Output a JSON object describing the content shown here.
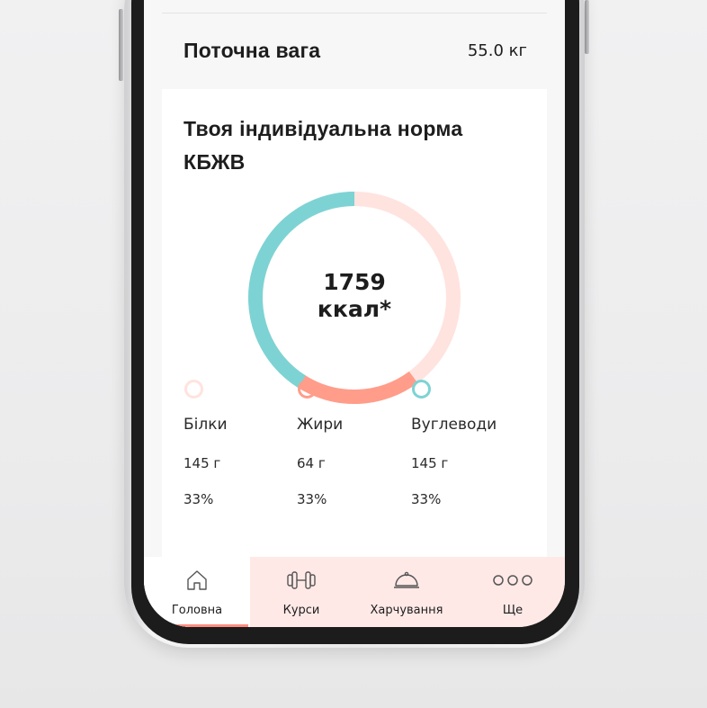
{
  "weight": {
    "label": "Поточна вага",
    "value": "55.0 кг"
  },
  "norm_card": {
    "title": "Твоя індивідуальна норма КБЖВ",
    "kcal_value": "1759",
    "kcal_unit": "ккал*"
  },
  "macros": [
    {
      "name": "Білки",
      "grams": "145 г",
      "percent": "33%",
      "color": "#ffe3df",
      "share": 0.33
    },
    {
      "name": "Жири",
      "grams": "64 г",
      "percent": "33%",
      "color": "#ff9d8a",
      "share": 0.33
    },
    {
      "name": "Вуглеводи",
      "grams": "145 г",
      "percent": "33%",
      "color": "#7dd3d4",
      "share": 0.33
    }
  ],
  "tabbar": {
    "tabs": [
      {
        "label": "Головна",
        "icon": "home-icon",
        "active": true
      },
      {
        "label": "Курси",
        "icon": "dumbbell-icon",
        "active": false
      },
      {
        "label": "Харчування",
        "icon": "cloche-icon",
        "active": false
      },
      {
        "label": "Ще",
        "icon": "more-icon",
        "active": false
      }
    ]
  },
  "colors": {
    "accent": "#ff8d7f",
    "tab_bg": "#ffe9e7",
    "protein": "#ffe3df",
    "fat": "#ff9d8a",
    "carbs": "#7dd3d4"
  }
}
